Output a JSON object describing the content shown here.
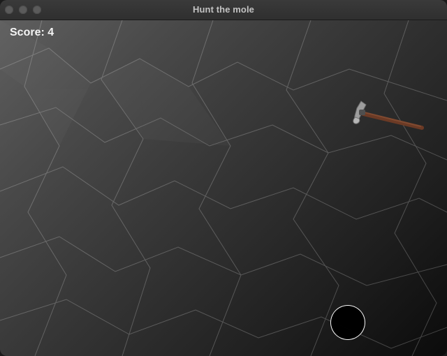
{
  "window": {
    "title": "Hunt the mole",
    "controls": [
      {
        "name": "close-button",
        "icon": "traffic-light-close"
      },
      {
        "name": "minimize-button",
        "icon": "traffic-light-minimize"
      },
      {
        "name": "maximize-button",
        "icon": "traffic-light-maximize"
      }
    ]
  },
  "hud": {
    "score_text": "Score: 4"
  },
  "scene": {
    "cursor": "hammer-icon",
    "target": "mole-hole"
  },
  "colors": {
    "titlebar": "#2f2f2f",
    "background_dark": "#0b0b0b",
    "score_text": "#f4f4f4",
    "hole": "#000000"
  }
}
